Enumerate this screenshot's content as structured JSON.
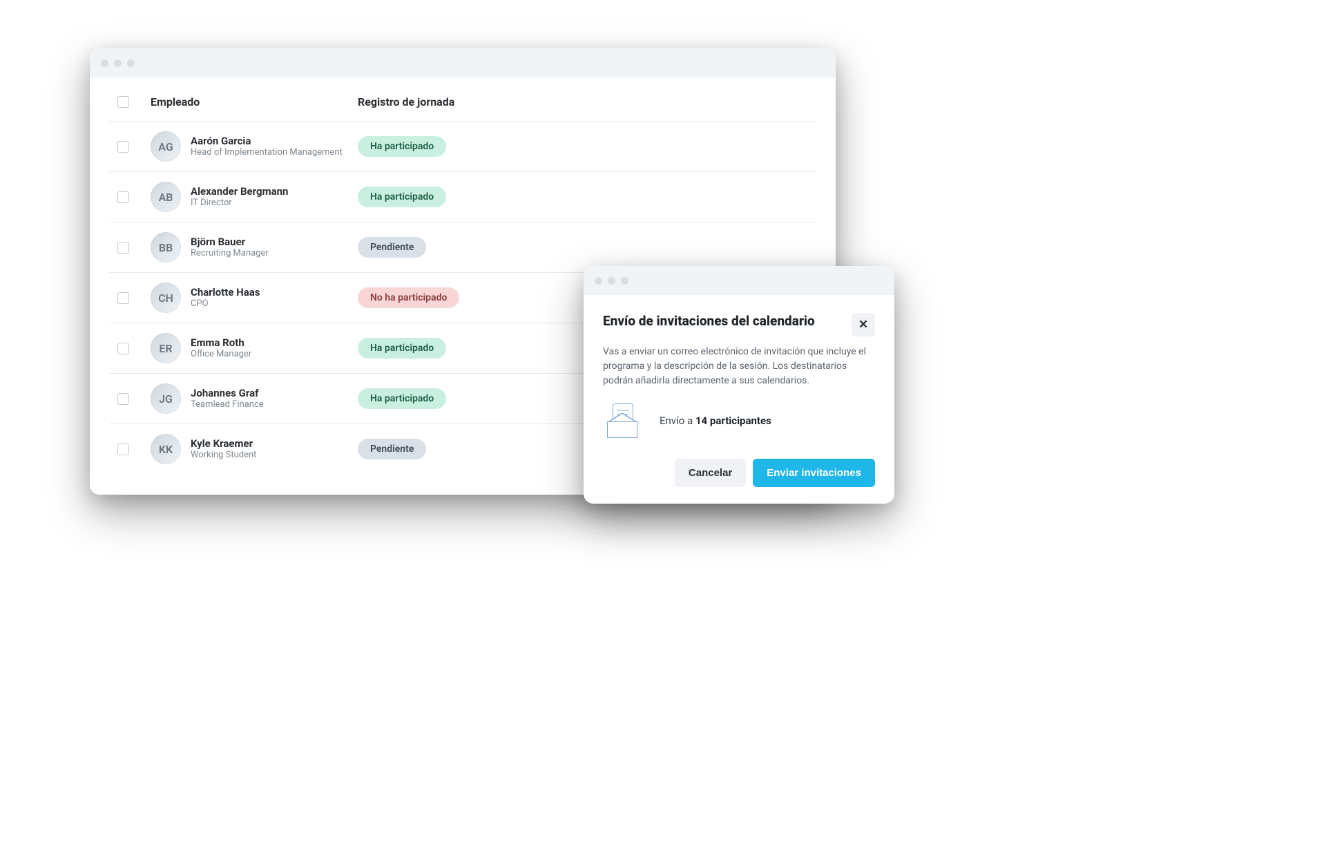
{
  "table": {
    "header": {
      "employee": "Empleado",
      "status": "Registro de jornada"
    },
    "statuses": {
      "green": "Ha participado",
      "gray": "Pendiente",
      "red": "No ha participado"
    },
    "rows": [
      {
        "name": "Aarón Garcia",
        "role": "Head of Implementation Management",
        "status": "green",
        "initials": "AG"
      },
      {
        "name": "Alexander Bergmann",
        "role": "IT Director",
        "status": "green",
        "initials": "AB"
      },
      {
        "name": "Björn Bauer",
        "role": "Recruiting Manager",
        "status": "gray",
        "initials": "BB"
      },
      {
        "name": "Charlotte Haas",
        "role": "CPO",
        "status": "red",
        "initials": "CH"
      },
      {
        "name": "Emma Roth",
        "role": "Office Manager",
        "status": "green",
        "initials": "ER"
      },
      {
        "name": "Johannes Graf",
        "role": "Teamlead Finance",
        "status": "green",
        "initials": "JG"
      },
      {
        "name": "Kyle Kraemer",
        "role": "Working Student",
        "status": "gray",
        "initials": "KK"
      }
    ]
  },
  "modal": {
    "title": "Envío de invitaciones del calendario",
    "description": "Vas a enviar un correo electrónico de invitación que incluye el programa y la descripción de la sesión. Los destinatarios podrán añadirla directamente a sus calendarios.",
    "send_prefix": "Envío a ",
    "send_bold": "14 participantes",
    "close_glyph": "✕",
    "cancel": "Cancelar",
    "submit": "Enviar invitaciones"
  }
}
